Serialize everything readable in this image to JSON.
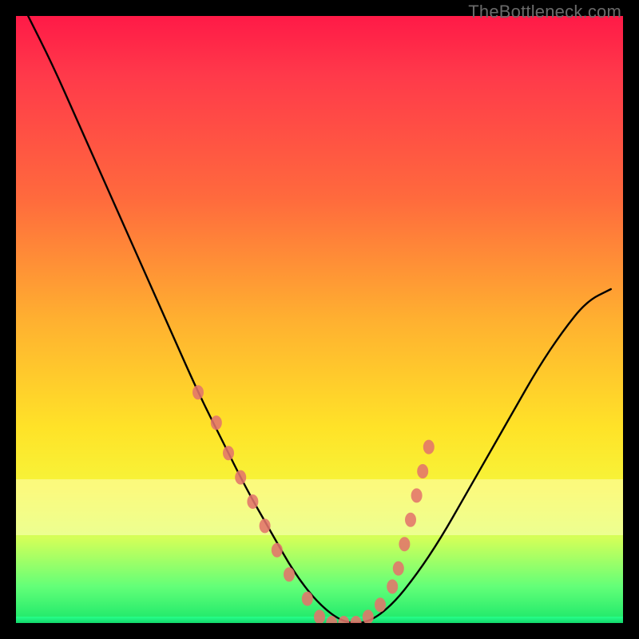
{
  "watermark": "TheBottleneck.com",
  "colors": {
    "gradient_top": "#ff1a47",
    "gradient_bottom": "#19e76a",
    "curve": "#000000",
    "markers": "#e2746b",
    "frame": "#000000"
  },
  "chart_data": {
    "type": "line",
    "title": "",
    "xlabel": "",
    "ylabel": "",
    "xlim": [
      0,
      100
    ],
    "ylim": [
      0,
      100
    ],
    "grid": false,
    "legend": false,
    "series": [
      {
        "name": "bottleneck-curve",
        "x": [
          2,
          6,
          10,
          14,
          18,
          22,
          26,
          30,
          34,
          38,
          42,
          46,
          50,
          54,
          58,
          62,
          66,
          70,
          74,
          78,
          82,
          86,
          90,
          94,
          98
        ],
        "y": [
          100,
          92,
          83,
          74,
          65,
          56,
          47,
          38,
          30,
          22,
          15,
          8,
          3,
          0,
          0,
          3,
          8,
          14,
          21,
          28,
          35,
          42,
          48,
          53,
          55
        ]
      }
    ],
    "markers": {
      "name": "highlighted-points",
      "points": [
        {
          "x": 30,
          "y": 38
        },
        {
          "x": 33,
          "y": 33
        },
        {
          "x": 35,
          "y": 28
        },
        {
          "x": 37,
          "y": 24
        },
        {
          "x": 39,
          "y": 20
        },
        {
          "x": 41,
          "y": 16
        },
        {
          "x": 43,
          "y": 12
        },
        {
          "x": 45,
          "y": 8
        },
        {
          "x": 48,
          "y": 4
        },
        {
          "x": 50,
          "y": 1
        },
        {
          "x": 52,
          "y": 0
        },
        {
          "x": 54,
          "y": 0
        },
        {
          "x": 56,
          "y": 0
        },
        {
          "x": 58,
          "y": 1
        },
        {
          "x": 60,
          "y": 3
        },
        {
          "x": 62,
          "y": 6
        },
        {
          "x": 63,
          "y": 9
        },
        {
          "x": 64,
          "y": 13
        },
        {
          "x": 65,
          "y": 17
        },
        {
          "x": 66,
          "y": 21
        },
        {
          "x": 67,
          "y": 25
        },
        {
          "x": 68,
          "y": 29
        }
      ]
    }
  }
}
